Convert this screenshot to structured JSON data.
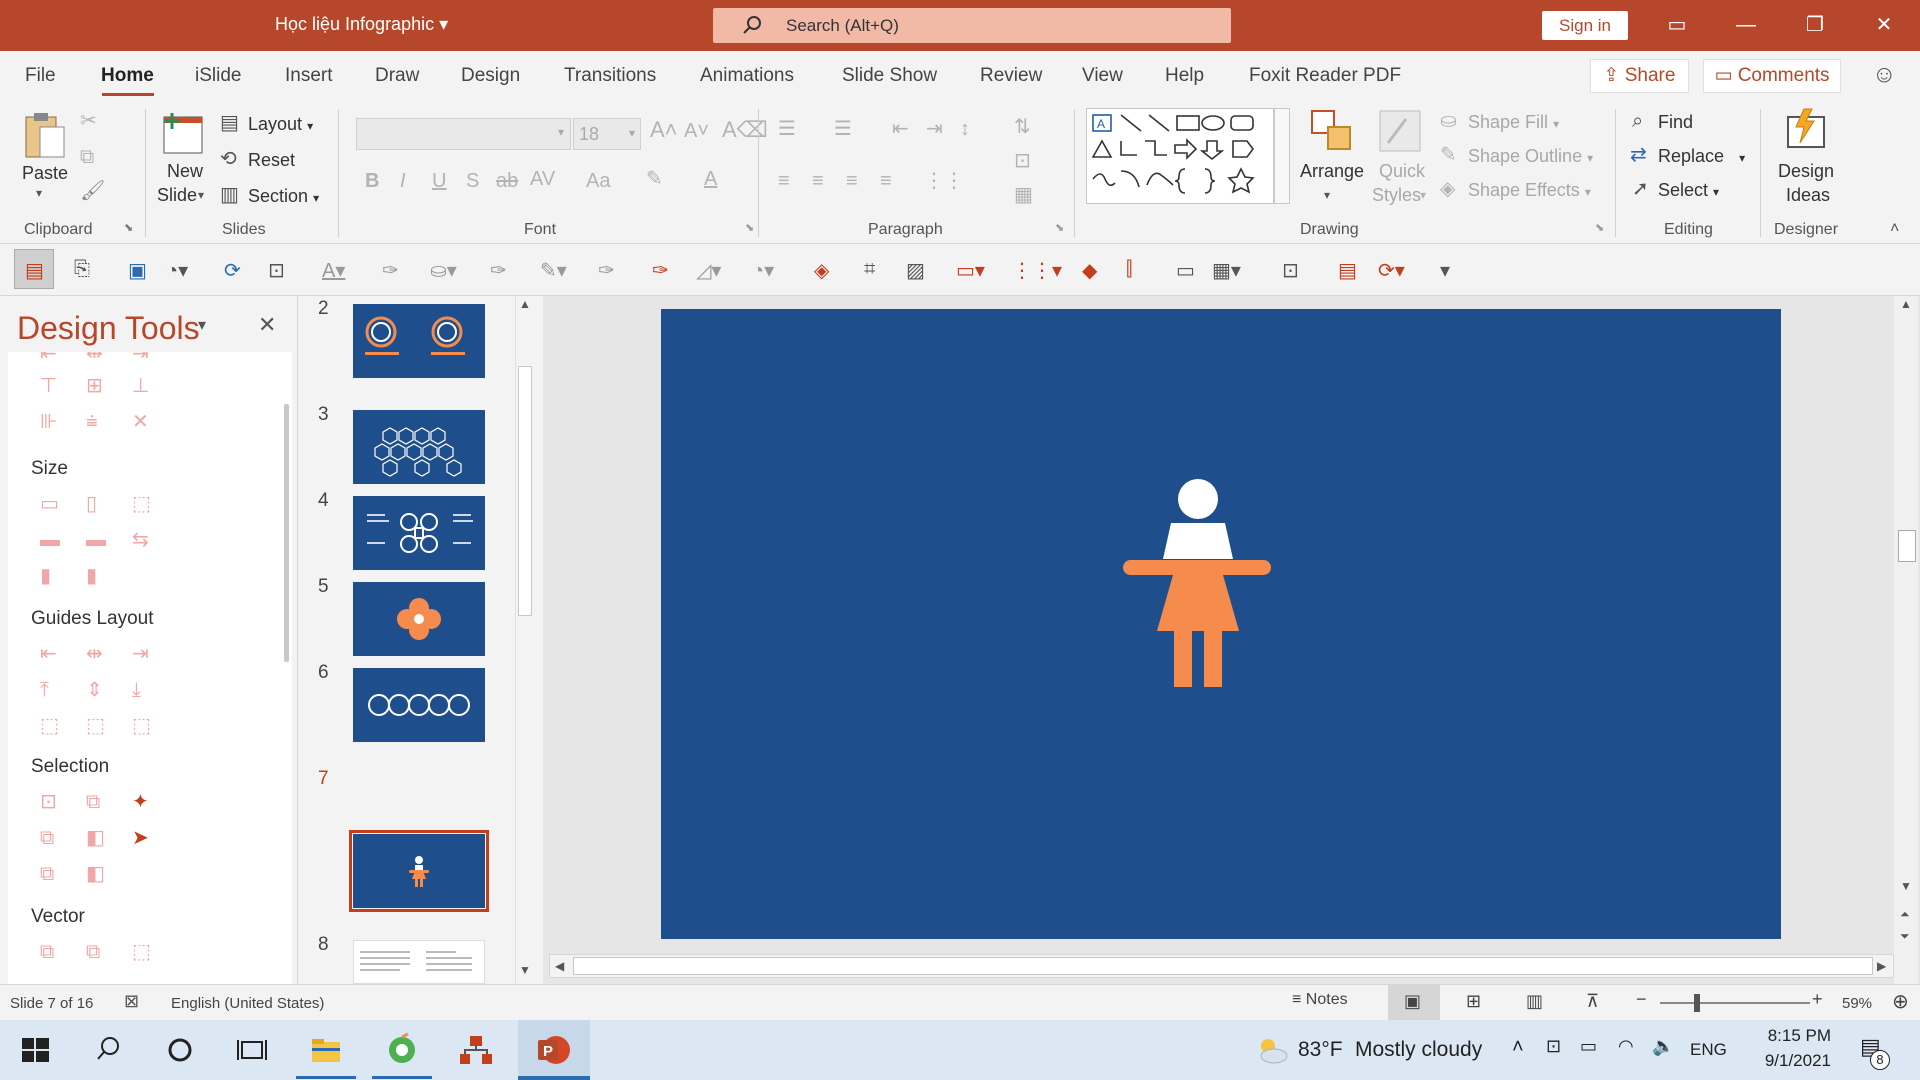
{
  "titlebar": {
    "doc_title": "Học liệu Infographic",
    "search_placeholder": "Search (Alt+Q)",
    "signin": "Sign in"
  },
  "menu": {
    "tabs": [
      "File",
      "Home",
      "iSlide",
      "Insert",
      "Draw",
      "Design",
      "Transitions",
      "Animations",
      "Slide Show",
      "Review",
      "View",
      "Help",
      "Foxit Reader PDF"
    ],
    "active": "Home",
    "share": "Share",
    "comments": "Comments"
  },
  "ribbon": {
    "clipboard": {
      "label": "Clipboard",
      "paste": "Paste"
    },
    "slides": {
      "label": "Slides",
      "new_slide_1": "New",
      "new_slide_2": "Slide",
      "layout": "Layout",
      "reset": "Reset",
      "section": "Section"
    },
    "font": {
      "label": "Font",
      "size": "18"
    },
    "paragraph": {
      "label": "Paragraph"
    },
    "drawing": {
      "label": "Drawing",
      "arrange": "Arrange",
      "quick_1": "Quick",
      "quick_2": "Styles",
      "shape_fill": "Shape Fill",
      "shape_outline": "Shape Outline",
      "shape_effects": "Shape Effects"
    },
    "editing": {
      "label": "Editing",
      "find": "Find",
      "replace": "Replace",
      "select": "Select"
    },
    "designer": {
      "label": "Designer",
      "ideas_1": "Design",
      "ideas_2": "Ideas"
    }
  },
  "design_pane": {
    "title": "Design Tools",
    "sections": [
      "Size",
      "Guides Layout",
      "Selection",
      "Vector"
    ]
  },
  "thumbnails": {
    "numbers": [
      "2",
      "3",
      "4",
      "5",
      "6",
      "7",
      "8"
    ],
    "selected": "7"
  },
  "statusbar": {
    "slide_info": "Slide 7 of 16",
    "language": "English (United States)",
    "notes": "Notes",
    "zoom": "59%"
  },
  "taskbar": {
    "weather_temp": "83°F",
    "weather_desc": "Mostly cloudy",
    "lang": "ENG",
    "time": "8:15 PM",
    "date": "9/1/2021",
    "notif_count": "8"
  },
  "colors": {
    "accent": "#b7472a",
    "slide_bg": "#1f4e8c",
    "figure_orange": "#f58c4e"
  }
}
